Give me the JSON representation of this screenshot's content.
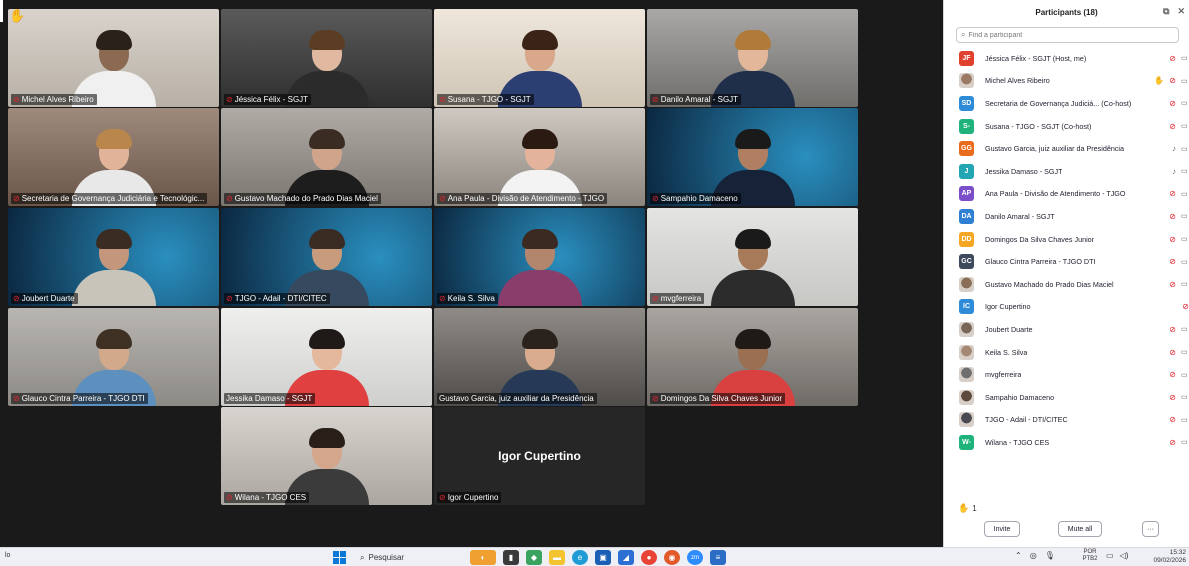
{
  "gallery": {
    "tiles": [
      {
        "name": "Michel Alves Ribeiro",
        "muted": true
      },
      {
        "name": "Jéssica Félix - SGJT",
        "muted": true
      },
      {
        "name": "Susana - TJGO - SGJT",
        "muted": true
      },
      {
        "name": "Danilo Amaral - SGJT",
        "muted": true
      },
      {
        "name": "Secretaria de Governança Judiciária e Tecnológic...",
        "muted": true
      },
      {
        "name": "Gustavo Machado do Prado Dias Maciel",
        "muted": true
      },
      {
        "name": "Ana Paula - Divisão de Atendimento - TJGO",
        "muted": true
      },
      {
        "name": "Sampahio Damaceno",
        "muted": true
      },
      {
        "name": "Joubert Duarte",
        "muted": true
      },
      {
        "name": "TJGO - Adail - DTI/CITEC",
        "muted": true
      },
      {
        "name": "Keila S. Silva",
        "muted": true
      },
      {
        "name": "mvgferreira",
        "muted": true
      },
      {
        "name": "Glauco Cintra Parreira - TJGO DTI",
        "muted": true
      },
      {
        "name": "Jessika Damaso - SGJT",
        "muted": false
      },
      {
        "name": "Gustavo Garcia, juiz auxiliar da Presidência",
        "muted": false
      },
      {
        "name": "Domingos Da Silva Chaves Junior",
        "muted": true
      },
      {
        "name": "Wilana - TJGO CES",
        "muted": true
      },
      {
        "name": "Igor Cupertino",
        "muted": true,
        "video_off": true,
        "display_name": "Igor Cupertino"
      }
    ],
    "active_speaker": "Gustavo Garcia, juiz auxiliar da Presidência",
    "hand_raise_icon": "raised-hand-icon"
  },
  "panel": {
    "title": "Participants (18)",
    "search_placeholder": "Find a participant",
    "participants": [
      {
        "initials": "JF",
        "name": "Jéssica Félix - SGJT (Host, me)",
        "color": "#e0412f",
        "mic": "off",
        "hand": false
      },
      {
        "initials": "",
        "name": "Michel Alves Ribeiro",
        "color": "#9b7a63",
        "mic": "off",
        "hand": true,
        "photo": true
      },
      {
        "initials": "SD",
        "name": "Secretaria de Governança Judiciá... (Co-host)",
        "color": "#2d8bd8",
        "mic": "off",
        "hand": false
      },
      {
        "initials": "S-",
        "name": "Susana - TJGO - SGJT (Co-host)",
        "color": "#1fb27b",
        "mic": "off",
        "hand": false
      },
      {
        "initials": "GG",
        "name": "Gustavo Garcia, juiz auxiliar da Presidência",
        "color": "#e86b1e",
        "mic": "on",
        "hand": false
      },
      {
        "initials": "J",
        "name": "Jessika Damaso - SGJT",
        "color": "#22a6b3",
        "mic": "on",
        "hand": false
      },
      {
        "initials": "AP",
        "name": "Ana Paula - Divisão de Atendimento - TJGO",
        "color": "#7b4fc9",
        "mic": "off",
        "hand": false
      },
      {
        "initials": "DA",
        "name": "Danilo Amaral - SGJT",
        "color": "#2f7fd3",
        "mic": "off",
        "hand": false
      },
      {
        "initials": "DD",
        "name": "Domingos Da Silva Chaves Junior",
        "color": "#f5a623",
        "mic": "off",
        "hand": false
      },
      {
        "initials": "GC",
        "name": "Glauco Cintra Parreira - TJGO DTI",
        "color": "#3c4a5c",
        "mic": "off",
        "hand": false
      },
      {
        "initials": "",
        "name": "Gustavo Machado do Prado Dias Maciel",
        "color": "#8a6e57",
        "mic": "off",
        "hand": false,
        "photo": true
      },
      {
        "initials": "IC",
        "name": "Igor Cupertino",
        "color": "#2d8bd8",
        "mic": "off",
        "hand": false,
        "no_cam": true
      },
      {
        "initials": "",
        "name": "Joubert Duarte",
        "color": "#7a6656",
        "mic": "off",
        "hand": false,
        "photo": true
      },
      {
        "initials": "",
        "name": "Keila S. Silva",
        "color": "#a58874",
        "mic": "off",
        "hand": false,
        "photo": true
      },
      {
        "initials": "",
        "name": "mvgferreira",
        "color": "#6f6f6f",
        "mic": "off",
        "hand": false,
        "photo": true
      },
      {
        "initials": "",
        "name": "Sampahio Damaceno",
        "color": "#5e4a3c",
        "mic": "off",
        "hand": false,
        "photo": true
      },
      {
        "initials": "",
        "name": "TJGO - Adail - DTI/CITEC",
        "color": "#4a4a52",
        "mic": "off",
        "hand": false,
        "photo": true
      },
      {
        "initials": "W-",
        "name": "Wilana - TJGO CES",
        "color": "#1fb27b",
        "mic": "off",
        "hand": false
      }
    ],
    "raised_hands_count": "1",
    "invite_label": "Invite",
    "mute_all_label": "Mute all",
    "more_label": "···"
  },
  "taskbar": {
    "left_text": "lo",
    "search_label": "Pesquisar",
    "lang_line1": "POR",
    "lang_line2": "PTB2",
    "time": "15:32",
    "date": "09/02/2026"
  }
}
